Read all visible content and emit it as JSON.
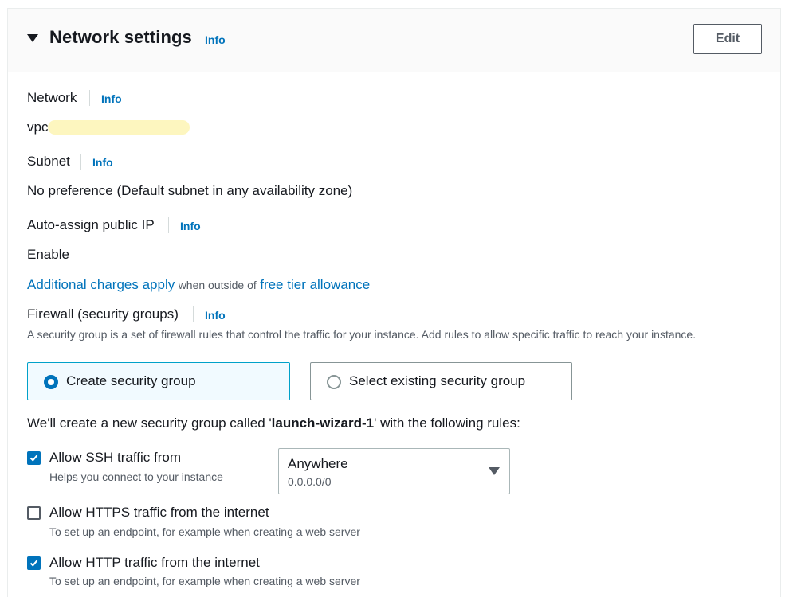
{
  "header": {
    "title": "Network settings",
    "info": "Info",
    "edit": "Edit"
  },
  "network": {
    "label": "Network",
    "info": "Info",
    "value": "vpc-"
  },
  "subnet": {
    "label": "Subnet",
    "info": "Info",
    "value": "No preference (Default subnet in any availability zone)"
  },
  "auto_ip": {
    "label": "Auto-assign public IP",
    "info": "Info",
    "value": "Enable"
  },
  "charges": {
    "link1": "Additional charges apply",
    "middle": "when outside of",
    "link2": "free tier allowance"
  },
  "firewall": {
    "label": "Firewall (security groups)",
    "info": "Info",
    "desc": "A security group is a set of firewall rules that control the traffic for your instance. Add rules to allow specific traffic to reach your instance.",
    "options": [
      {
        "label": "Create security group",
        "selected": true
      },
      {
        "label": "Select existing security group",
        "selected": false
      }
    ],
    "notice_prefix": "We'll create a new security group called '",
    "notice_name": "launch-wizard-1",
    "notice_suffix": "' with the following rules:"
  },
  "rules": [
    {
      "label": "Allow SSH traffic from",
      "desc": "Helps you connect to your instance",
      "checked": true
    },
    {
      "label": "Allow HTTPS traffic from the internet",
      "desc": "To set up an endpoint, for example when creating a web server",
      "checked": false
    },
    {
      "label": "Allow HTTP traffic from the internet",
      "desc": "To set up an endpoint, for example when creating a web server",
      "checked": true
    }
  ],
  "ssh_source": {
    "value": "Anywhere",
    "sub": "0.0.0.0/0"
  },
  "colors": {
    "link": "#0073bb",
    "checkbox_on": "#0073bb",
    "selected_tile_bg": "#f1faff",
    "redaction": "#fdf6bf"
  }
}
